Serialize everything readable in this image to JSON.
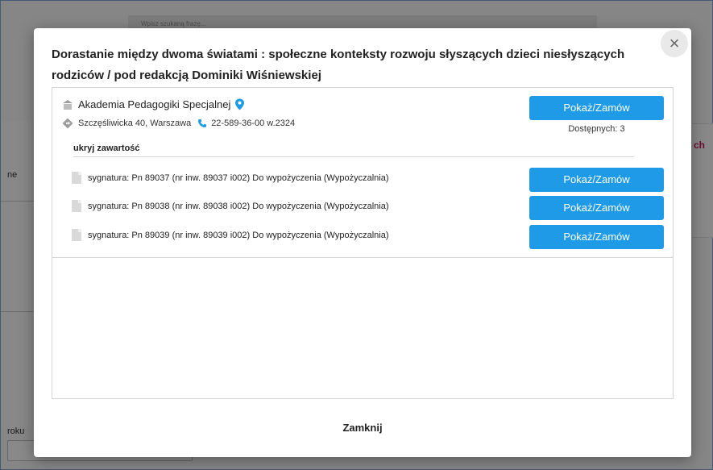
{
  "background": {
    "search_placeholder": "Wpisz szukaną frazę...",
    "left_text": "ne",
    "roku_text": "roku",
    "right_text": "ch"
  },
  "modal": {
    "title": "Dorastanie między dwoma światami : społeczne konteksty rozwoju słyszących dzieci niesłyszących rodziców / pod redakcją Dominiki Wiśniewskiej",
    "close_symbol": "×",
    "library": {
      "name": "Akademia Pedagogiki Specjalnej",
      "address": "Szczęśliwicka 40, Warszawa",
      "phone": "22-589-36-00 w.2324",
      "button_label": "Pokaż/Zamów",
      "available": "Dostępnych: 3",
      "toggle_label": "ukryj zawartość"
    },
    "items": [
      {
        "text": "sygnatura: Pn 89037 (nr inw. 89037 i002) Do wypożyczenia (Wypożyczalnia)",
        "button_label": "Pokaż/Zamów"
      },
      {
        "text": "sygnatura: Pn 89038 (nr inw. 89038 i002) Do wypożyczenia (Wypożyczalnia)",
        "button_label": "Pokaż/Zamów"
      },
      {
        "text": "sygnatura: Pn 89039 (nr inw. 89039 i002) Do wypożyczenia (Wypożyczalnia)",
        "button_label": "Pokaż/Zamów"
      }
    ],
    "close_label": "Zamknij"
  },
  "colors": {
    "accent": "#1e9ae6",
    "highlight": "#c2185b"
  }
}
